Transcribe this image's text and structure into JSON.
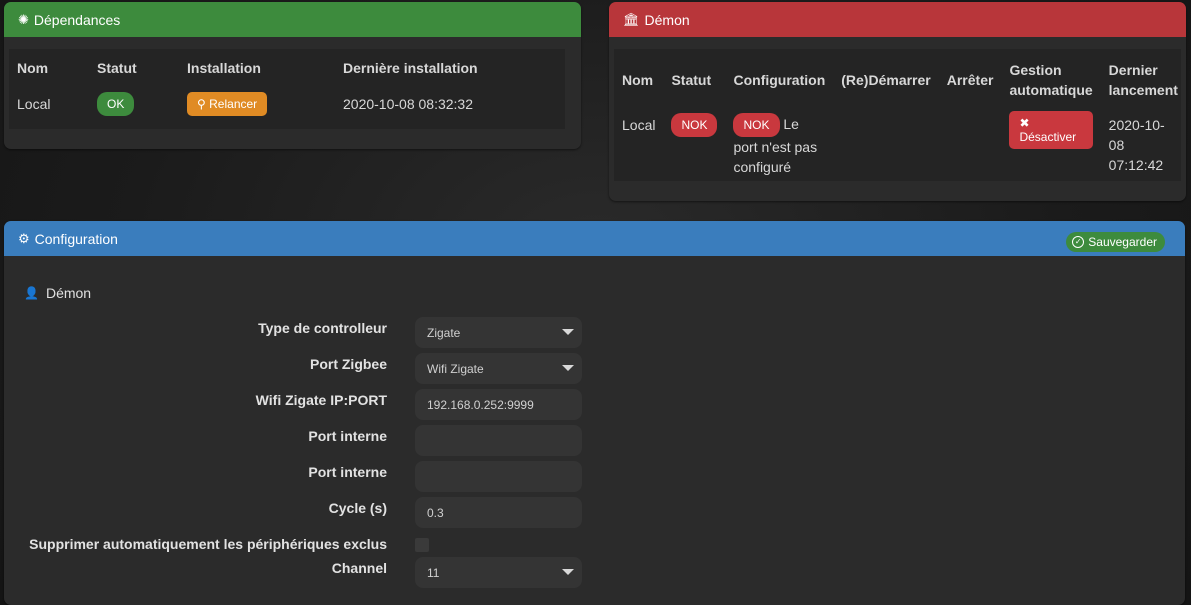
{
  "dependencies": {
    "title": "Dépendances",
    "headers": [
      "Nom",
      "Statut",
      "Installation",
      "Dernière installation"
    ],
    "row": {
      "name": "Local",
      "status": "OK",
      "install_button": "Relancer",
      "last_install": "2020-10-08 08:32:32"
    },
    "color": "#3d8b3d"
  },
  "daemon": {
    "title": "Démon",
    "headers": {
      "name": "Nom",
      "status": "Statut",
      "config": "Configuration",
      "restart": "(Re)Démarrer",
      "stop": "Arrêter",
      "auto_1": "Gestion",
      "auto_2": "automatique",
      "last_1": "Dernier",
      "last_2": "lancement"
    },
    "row": {
      "name": "Local",
      "status": "NOK",
      "config_badge": "NOK",
      "config_text_1": "Le",
      "config_text_2": "port n'est pas",
      "config_text_3": "configuré",
      "auto_button": "Désactiver",
      "last_date": "2020-10-08",
      "last_time": "07:12:42"
    },
    "color": "#b8363a"
  },
  "configuration": {
    "title": "Configuration",
    "save_button": "Sauvegarder",
    "section_title": "Démon",
    "fields": [
      {
        "label": "Type de controlleur",
        "value": "Zigate",
        "kind": "select"
      },
      {
        "label": "Port Zigbee",
        "value": "Wifi Zigate",
        "kind": "select"
      },
      {
        "label": "Wifi Zigate IP:PORT",
        "value": "192.168.0.252:9999",
        "kind": "input"
      },
      {
        "label": "Port interne",
        "value": "",
        "kind": "input"
      },
      {
        "label": "Port interne",
        "value": "",
        "kind": "input"
      },
      {
        "label": "Cycle (s)",
        "value": "0.3",
        "kind": "input"
      },
      {
        "label": "Supprimer automatiquement les périphériques exclus",
        "value": "",
        "kind": "checkbox"
      },
      {
        "label": "Channel",
        "value": "11",
        "kind": "select"
      }
    ],
    "color": "#3a7dbd"
  }
}
